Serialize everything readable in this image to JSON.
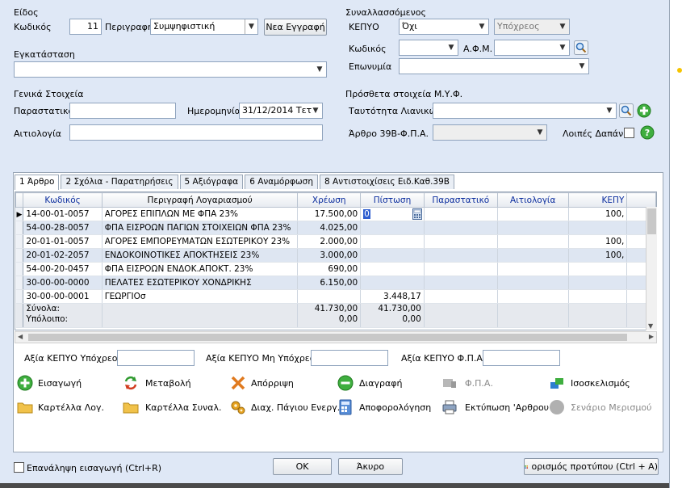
{
  "header": {
    "type_section": "Είδος",
    "code_label": "Κωδικός",
    "code_value": "11",
    "description_label": "Περιγραφή",
    "description_value": "Συμψηφιστική",
    "new_record_button": "Νεα Εγγραφή",
    "installation_label": "Εγκατάσταση",
    "installation_value": "",
    "general_section": "Γενικά Στοιχεία",
    "document_label": "Παραστατικό",
    "document_value": "",
    "date_label": "Ημερομηνία",
    "date_value": "31/12/2014 Τετ",
    "reason_label": "Αιτιολογία",
    "reason_value": ""
  },
  "counterparty": {
    "section": "Συναλλασσόμενος",
    "kepyo_label": "ΚΕΠΥΟ",
    "kepyo_value": "Όχι",
    "obliged_value": "Υπόχρεος",
    "code_label": "Κωδικός",
    "code_value": "",
    "afm_label": "Α.Φ.Μ.",
    "afm_value": "",
    "name_label": "Επωνυμία",
    "name_value": ""
  },
  "myf": {
    "section": "Πρόσθετα στοιχεία Μ.Υ.Φ.",
    "retail_id_label": "Ταυτότητα Λιανικών",
    "retail_id_value": "",
    "article_label": "Άρθρο 39Β-Φ.Π.Α.",
    "article_value": "",
    "other_expenses_label": "Λοιπές Δαπάνες"
  },
  "tabs": [
    {
      "label": "1 Άρθρο"
    },
    {
      "label": "2 Σχόλια - Παρατηρήσεις"
    },
    {
      "label": "5 Αξιόγραφα"
    },
    {
      "label": "6 Αναμόρφωση"
    },
    {
      "label": "8 Αντιστοιχίσεις Ειδ.Καθ.39Β"
    }
  ],
  "grid": {
    "columns": [
      "Κωδικός",
      "Περιγραφή Λογαριασμού",
      "Χρέωση",
      "Πίστωση",
      "Παραστατικό",
      "Αιτιολογία",
      "ΚΕΠΥ"
    ],
    "rows": [
      {
        "code": "14-00-01-0057",
        "desc": "ΑΓΟΡΕΣ ΕΠΙΠΛΩΝ ΜΕ ΦΠΑ 23%",
        "debit": "17.500,00",
        "credit": "0",
        "doc": "",
        "reason": "",
        "kepy": "100,"
      },
      {
        "code": "54-00-28-0057",
        "desc": "ΦΠΑ ΕΙΣΡΟΩΝ ΠΑΓΙΩΝ ΣΤΟΙΧΕΙΩΝ ΦΠΑ 23%",
        "debit": "4.025,00",
        "credit": "",
        "doc": "",
        "reason": "",
        "kepy": ""
      },
      {
        "code": "20-01-01-0057",
        "desc": "ΑΓΟΡΕΣ ΕΜΠΟΡΕΥΜΑΤΩΝ ΕΣΩΤΕΡΙΚΟΥ 23%",
        "debit": "2.000,00",
        "credit": "",
        "doc": "",
        "reason": "",
        "kepy": "100,"
      },
      {
        "code": "20-01-02-2057",
        "desc": "ΕΝΔΟΚΟΙΝΟΤΙΚΕΣ ΑΠΟΚΤΗΣΕΙΣ 23%",
        "debit": "3.000,00",
        "credit": "",
        "doc": "",
        "reason": "",
        "kepy": "100,"
      },
      {
        "code": "54-00-20-0457",
        "desc": "ΦΠΑ ΕΙΣΡΟΩΝ ΕΝΔΟΚ.ΑΠΟΚΤ. 23%",
        "debit": "690,00",
        "credit": "",
        "doc": "",
        "reason": "",
        "kepy": ""
      },
      {
        "code": "30-00-00-0000",
        "desc": "ΠΕΛΑΤΕΣ ΕΣΩΤΕΡΙΚΟΥ ΧΟΝΔΡΙΚΗΣ",
        "debit": "6.150,00",
        "credit": "",
        "doc": "",
        "reason": "",
        "kepy": ""
      },
      {
        "code": "30-00-00-0001",
        "desc": "ΓΕΩΡΓΙΟσ",
        "debit": "",
        "credit": "3.448,17",
        "doc": "",
        "reason": "",
        "kepy": ""
      }
    ],
    "totals_label": "Σύνολα:",
    "balance_label": "Υπόλοιπο:",
    "total_debit": "41.730,00",
    "total_credit": "41.730,00",
    "balance_debit": "0,00",
    "balance_credit": "0,00"
  },
  "kepyo_values": {
    "obliged_label": "Αξία ΚΕΠΥΟ Υπόχρεου",
    "obliged_value": "",
    "non_obliged_label": "Αξία ΚΕΠΥΟ Μη Υπόχρεου",
    "non_obliged_value": "",
    "vat_label": "Αξία ΚΕΠΥΟ Φ.Π.Α.",
    "vat_value": ""
  },
  "actions": {
    "insert": "Εισαγωγή",
    "modify": "Μεταβολή",
    "reject": "Απόρριψη",
    "delete": "Διαγραφή",
    "vat": "Φ.Π.Α.",
    "balance": "Ισοσκελισμός",
    "account_card": "Καρτέλλα Λογ.",
    "trans_card": "Καρτέλλα Συναλ.",
    "asset_mgmt": "Διαχ. Πάγιου Ενεργ.",
    "depreciation": "Αποφορολόγηση",
    "print_article": "Εκτύπωση 'Αρθρου",
    "allocation": "Σενάριο Μερισμού"
  },
  "footer": {
    "repeat_insert": "Επανάληψη εισαγωγή (Ctrl+R)",
    "ok": "ΟΚ",
    "cancel": "Άκυρο",
    "template": "ορισμός προτύπου (Ctrl + A)"
  },
  "colors": {
    "accent_blue": "#0b2d9e",
    "row_alt": "#dee6f2",
    "background": "#dfe8f6"
  }
}
